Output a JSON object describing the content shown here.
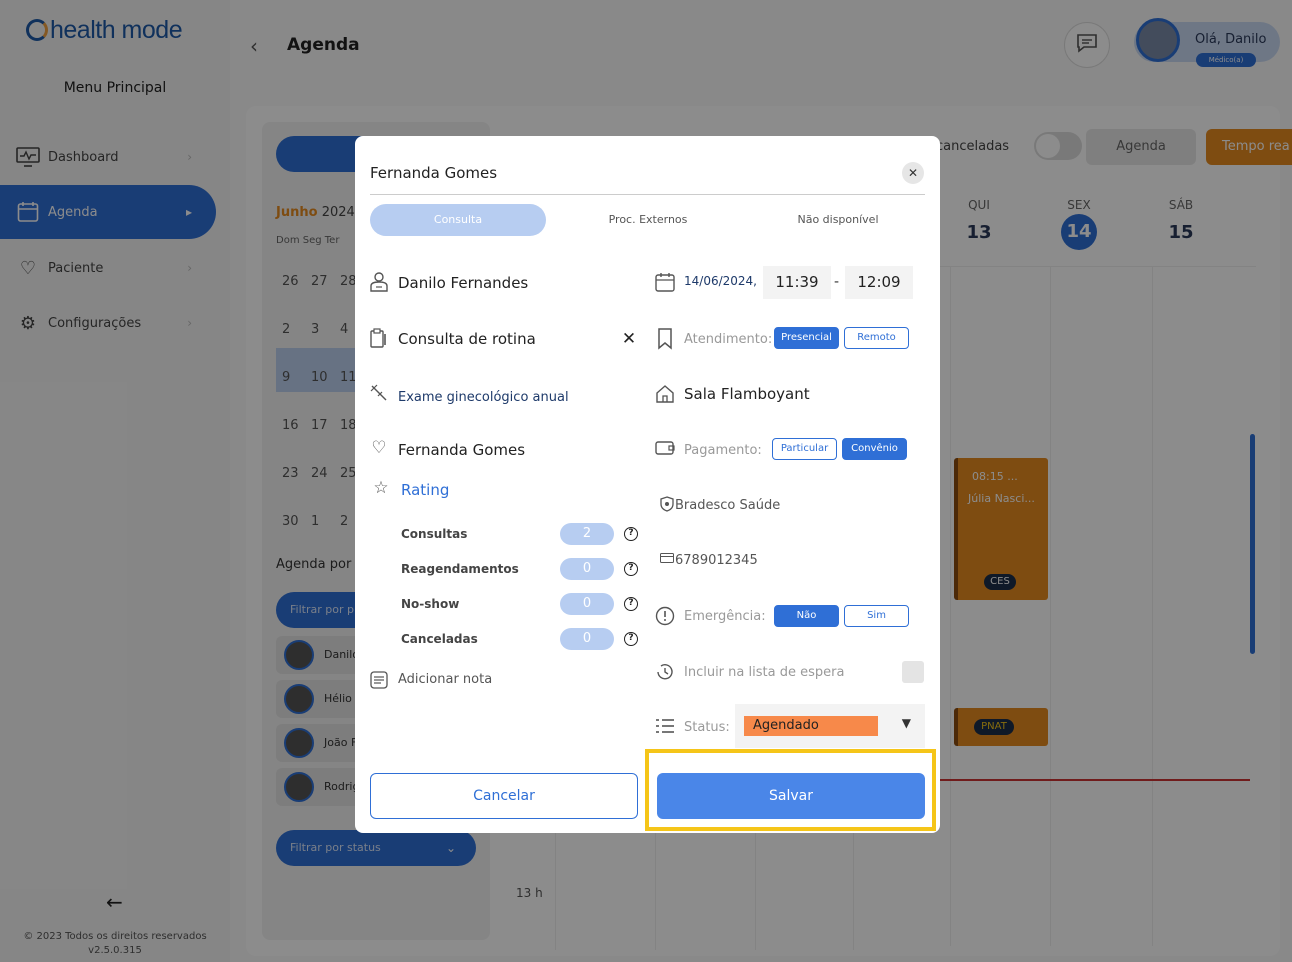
{
  "sidebar": {
    "logo": "health mode",
    "menu_title": "Menu Principal",
    "items": [
      {
        "label": "Dashboard",
        "icon": "monitor-icon"
      },
      {
        "label": "Agenda",
        "icon": "calendar-icon"
      },
      {
        "label": "Paciente",
        "icon": "heart-icon"
      },
      {
        "label": "Configurações",
        "icon": "gear-icon"
      }
    ],
    "copyright": "© 2023 Todos os direitos reservados",
    "version": "v2.5.0.315"
  },
  "header": {
    "title": "Agenda",
    "user_greeting": "Olá, Danilo",
    "user_role": "Médico(a)"
  },
  "calendar": {
    "month": "Junho",
    "year": "2024",
    "weekdays": "Dom Seg Ter",
    "days": [
      [
        "26",
        "27",
        "28"
      ],
      [
        "2",
        "3",
        "4"
      ],
      [
        "9",
        "10",
        "11"
      ],
      [
        "16",
        "17",
        "18"
      ],
      [
        "23",
        "24",
        "25"
      ],
      [
        "30",
        "1",
        "2"
      ]
    ],
    "agenda_por": "Agenda por",
    "filter_placeholder": "Filtrar por pr",
    "professionals": [
      "Danilo",
      "Hélio S",
      "João F",
      "Rodrig"
    ],
    "status_filter": "Filtrar por status"
  },
  "week_view": {
    "show_cancelled": "canceladas",
    "agenda_btn": "Agenda",
    "tempo_btn": "Tempo rea",
    "days": [
      {
        "name": "QUI",
        "num": "13"
      },
      {
        "name": "SEX",
        "num": "14"
      },
      {
        "name": "SÁB",
        "num": "15"
      }
    ],
    "appointment": {
      "time": "08:15 ...",
      "name": "Júlia Nasci...",
      "tag": "CES"
    },
    "appointment2": {
      "tag": "PNAT"
    },
    "hour_label": "13 h"
  },
  "modal": {
    "patient_name": "Fernanda Gomes",
    "tabs": [
      "Consulta",
      "Proc. Externos",
      "Não disponível"
    ],
    "doctor": "Danilo Fernandes",
    "consult_type": "Consulta de rotina",
    "procedure": "Exame ginecológico anual",
    "patient": "Fernanda Gomes",
    "rating_label": "Rating",
    "stats": [
      {
        "label": "Consultas",
        "value": "2"
      },
      {
        "label": "Reagendamentos",
        "value": "0"
      },
      {
        "label": "No-show",
        "value": "0"
      },
      {
        "label": "Canceladas",
        "value": "0"
      }
    ],
    "add_note": "Adicionar nota",
    "date": "14/06/2024",
    "time_start": "11:39",
    "time_end": "12:09",
    "atendimento_label": "Atendimento:",
    "atendimento_options": [
      "Presencial",
      "Remoto"
    ],
    "room": "Sala Flamboyant",
    "pagamento_label": "Pagamento:",
    "pagamento_options": [
      "Particular",
      "Convênio"
    ],
    "insurance": "Bradesco Saúde",
    "card_number": "6789012345",
    "emergencia_label": "Emergência:",
    "emergencia_options": [
      "Não",
      "Sim"
    ],
    "waitlist_label": "Incluir na lista de espera",
    "status_label": "Status:",
    "status_value": "Agendado",
    "cancel_btn": "Cancelar",
    "save_btn": "Salvar"
  },
  "colors": {
    "primary": "#2f6fd6",
    "accent": "#e58a20",
    "status_agendado": "#f7894a",
    "highlight": "#f5c518"
  }
}
